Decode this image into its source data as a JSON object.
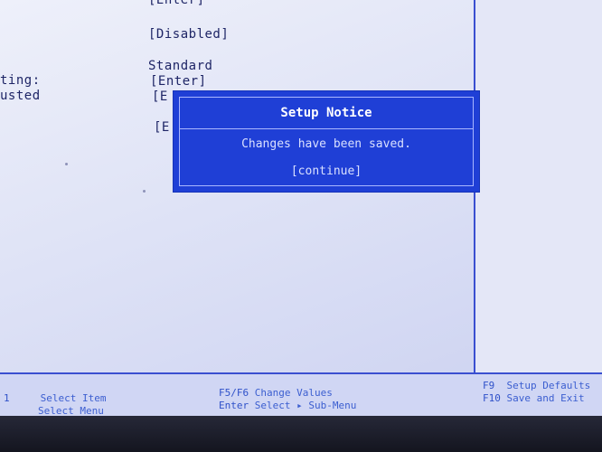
{
  "settings": {
    "row1_value": "[Enter]",
    "row2_value": "[Disabled]",
    "row3_value": "Standard",
    "row4_label": "ting:",
    "row4_value": "[Enter]",
    "row5_label": "usted",
    "row5_value": "[E",
    "row6_value": "[E"
  },
  "dialog": {
    "title": "Setup Notice",
    "message": "Changes have been saved.",
    "continue_label": "[continue]"
  },
  "footer": {
    "left": [
      {
        "key": "1",
        "desc": "Select Item"
      },
      {
        "key": "",
        "desc": "Select Menu"
      }
    ],
    "middle": [
      {
        "key": "F5/F6",
        "desc": "Change Values"
      },
      {
        "key": "Enter",
        "desc": "Select ▸ Sub-Menu"
      }
    ],
    "right": [
      {
        "key": "F9",
        "desc": "Setup Defaults"
      },
      {
        "key": "F10",
        "desc": "Save and Exit"
      }
    ]
  },
  "colors": {
    "dialog_bg": "#1f3fd6",
    "screen_bg": "#dfe3f6",
    "text": "#1e2566",
    "footer_text": "#2b49c8"
  }
}
